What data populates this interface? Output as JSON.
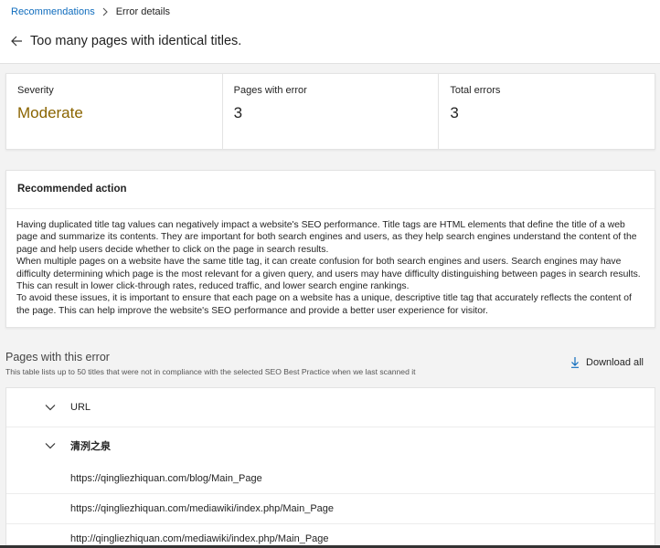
{
  "breadcrumb": {
    "parent": "Recommendations",
    "current": "Error details"
  },
  "page_title": "Too many pages with identical titles.",
  "stats": [
    {
      "label": "Severity",
      "value": "Moderate"
    },
    {
      "label": "Pages with error",
      "value": "3"
    },
    {
      "label": "Total errors",
      "value": "3"
    }
  ],
  "recommended": {
    "heading": "Recommended action",
    "paragraphs": [
      "Having duplicated title tag values can negatively impact a website's SEO performance. Title tags are HTML elements that define the title of a web page and summarize its contents. They are important for both search engines and users, as they help search engines understand the content of the page and help users decide whether to click on the page in search results.",
      "When multiple pages on a website have the same title tag, it can create confusion for both search engines and users. Search engines may have difficulty determining which page is the most relevant for a given query, and users may have difficulty distinguishing between pages in search results. This can result in lower click-through rates, reduced traffic, and lower search engine rankings.",
      "To avoid these issues, it is important to ensure that each page on a website has a unique, descriptive title tag that accurately reflects the content of the page. This can help improve the website's SEO performance and provide a better user experience for visitor."
    ]
  },
  "pages": {
    "title": "Pages with this error",
    "subtitle": "This table lists up to 50 titles that were not in compliance with the selected SEO Best Practice when we last scanned it",
    "download_label": "Download all",
    "column_header": "URL",
    "group_title": "清洌之泉",
    "urls": [
      "https://qingliezhiquan.com/blog/Main_Page",
      "https://qingliezhiquan.com/mediawiki/index.php/Main_Page",
      "http://qingliezhiquan.com/mediawiki/index.php/Main_Page"
    ]
  },
  "colors": {
    "link": "#0f6cbd",
    "severity_moderate": "#8a6400"
  },
  "icons": {
    "breadcrumb_separator": "chevron-right-icon",
    "back": "arrow-left-icon",
    "download": "download-icon",
    "expand": "chevron-down-icon"
  }
}
